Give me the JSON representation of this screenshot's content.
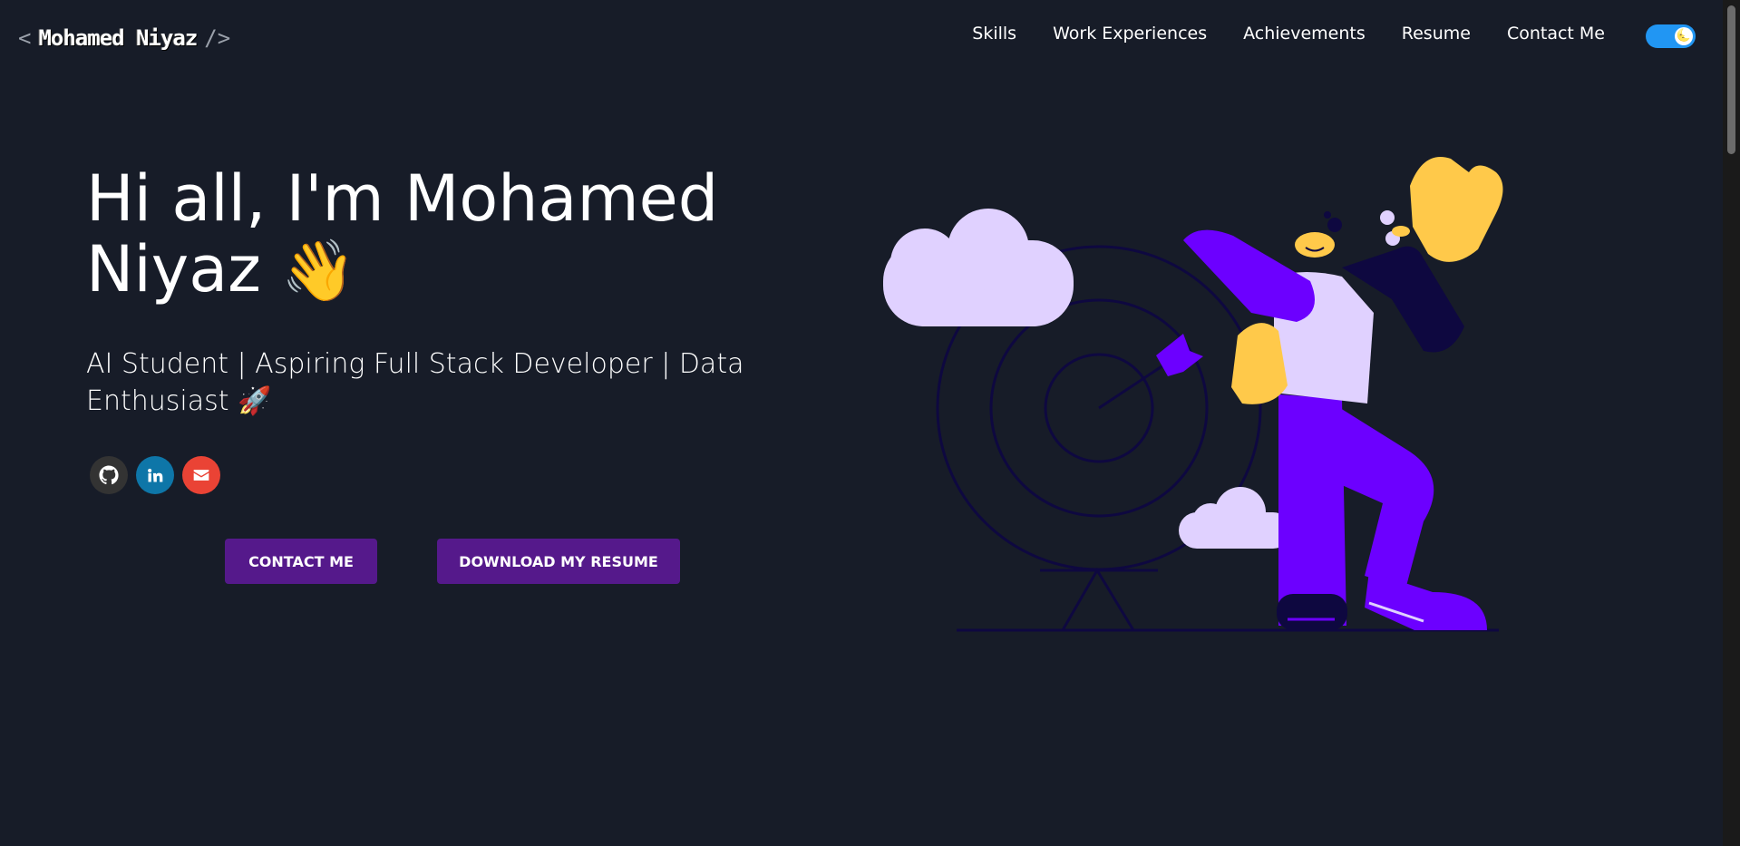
{
  "header": {
    "logo_open": "<",
    "logo_name": "Mohamed Niyaz",
    "logo_close": "/>",
    "nav": [
      "Skills",
      "Work Experiences",
      "Achievements",
      "Resume",
      "Contact Me"
    ],
    "theme_toggle_icon": "🌜"
  },
  "hero": {
    "title": "Hi all, I'm Mohamed Niyaz",
    "wave_emoji": "👋",
    "subtitle": "AI Student | Aspiring Full Stack Developer | Data Enthusiast",
    "rocket_emoji": "🚀",
    "socials": [
      {
        "name": "github-icon",
        "color": "#333333"
      },
      {
        "name": "linkedin-icon",
        "color": "#0e76a8"
      },
      {
        "name": "gmail-icon",
        "color": "#ea4335"
      }
    ],
    "buttons": {
      "contact": "CONTACT ME",
      "resume": "DOWNLOAD MY RESUME"
    }
  },
  "colors": {
    "background": "#171c28",
    "button": "#55198b",
    "accent_purple": "#6c00ff",
    "toggle": "#2196f3"
  }
}
